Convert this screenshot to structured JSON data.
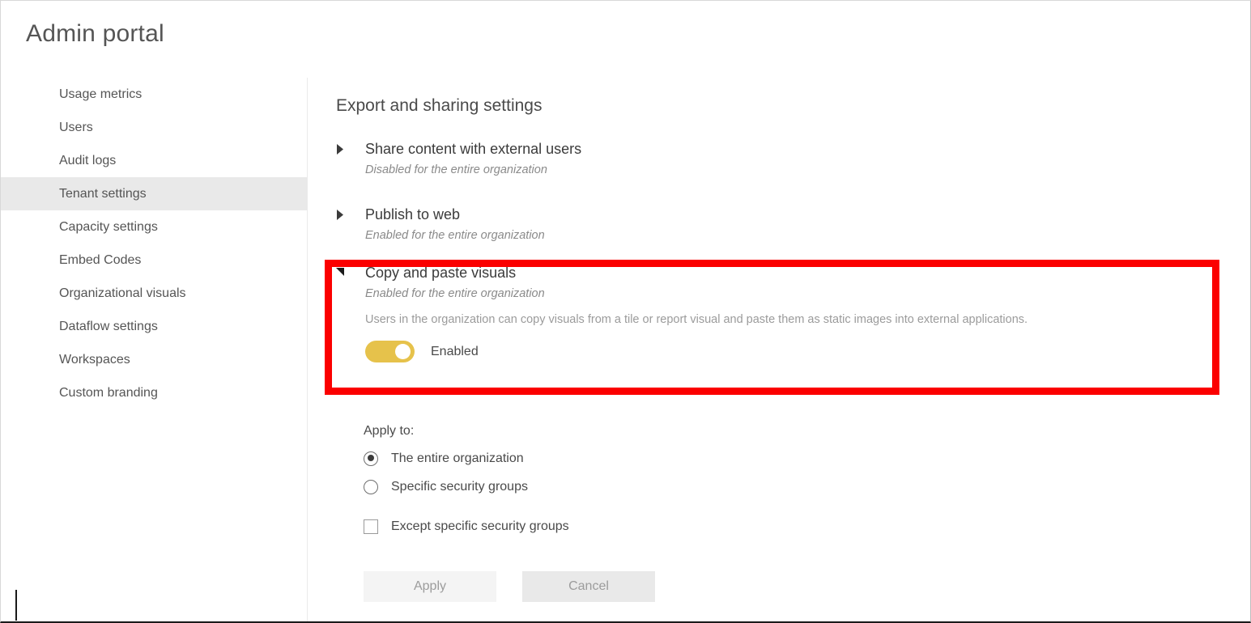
{
  "header": {
    "title": "Admin portal"
  },
  "sidebar": {
    "items": [
      {
        "label": "Usage metrics",
        "selected": false
      },
      {
        "label": "Users",
        "selected": false
      },
      {
        "label": "Audit logs",
        "selected": false
      },
      {
        "label": "Tenant settings",
        "selected": true
      },
      {
        "label": "Capacity settings",
        "selected": false
      },
      {
        "label": "Embed Codes",
        "selected": false
      },
      {
        "label": "Organizational visuals",
        "selected": false
      },
      {
        "label": "Dataflow settings",
        "selected": false
      },
      {
        "label": "Workspaces",
        "selected": false
      },
      {
        "label": "Custom branding",
        "selected": false
      }
    ]
  },
  "main": {
    "section_title": "Export and sharing settings",
    "settings": [
      {
        "name": "Share content with external users",
        "state": "Disabled for the entire organization",
        "expanded": false,
        "chevron": "chevron-right-icon"
      },
      {
        "name": "Publish to web",
        "state": "Enabled for the entire organization",
        "expanded": false,
        "chevron": "chevron-right-icon"
      },
      {
        "name": "Copy and paste visuals",
        "state": "Enabled for the entire organization",
        "description": "Users in the organization can copy visuals from a tile or report visual and paste them as static images into external applications.",
        "expanded": true,
        "chevron": "chevron-down-icon",
        "toggle": {
          "label": "Enabled",
          "on": true,
          "on_color": "#e6c24b",
          "knob_color": "#ffffff"
        }
      }
    ],
    "apply_to": {
      "label": "Apply to:",
      "radios": [
        {
          "label": "The entire organization",
          "checked": true
        },
        {
          "label": "Specific security groups",
          "checked": false
        }
      ],
      "checkbox": {
        "label": "Except specific security groups",
        "checked": false
      }
    },
    "buttons": {
      "apply": "Apply",
      "cancel": "Cancel"
    }
  },
  "annotation": {
    "highlight_color": "#fb0000",
    "target": "Copy and paste visuals"
  }
}
